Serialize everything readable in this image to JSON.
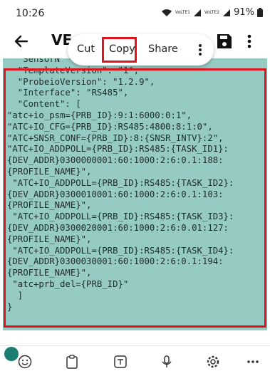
{
  "status_bar": {
    "time": "10:26",
    "network_left": "VoLTE1",
    "network_right": "VoLTE2",
    "battery": "91%"
  },
  "app_bar": {
    "title": "VE",
    "back_icon": "back-arrow-icon",
    "save_icon": "save-icon",
    "more_icon": "more-vertical-icon"
  },
  "context_menu": {
    "cut": "Cut",
    "copy": "Copy",
    "share": "Share",
    "more_icon": "more-vertical-icon"
  },
  "editor": {
    "code_lines": [
      "  \"SensorN",
      "  \"TemplateVersion\": \"1\",",
      "  \"ProbeioVersion\": \"1.2.9\",",
      "  \"Interface\": \"RS485\",",
      "  \"Content\": [",
      "\"atc+io_psm={PRB_ID}:9:1:6000:0:1\",",
      "\"ATC+IO_CFG={PRB_ID}:RS485:4800:8:1:0\",",
      "\"ATC+SNSR_CONF={PRB_ID}:8:{SNSR_INTV}:2\",",
      "\"ATC+IO_ADDPOLL={PRB_ID}:RS485:{TASK_ID1}:",
      "{DEV_ADDR}0300000001:60:1000:2:6:0.1:188:",
      "{PROFILE_NAME}\",",
      " \"ATC+IO_ADDPOLL={PRB_ID}:RS485:{TASK_ID2}:",
      "{DEV_ADDR}0300010001:60:1000:2:6:0.1:103:",
      "{PROFILE_NAME}\",",
      " \"ATC+IO_ADDPOLL={PRB_ID}:RS485:{TASK_ID3}:",
      "{DEV_ADDR}0300020001:60:1000:2:6:0.01:127:",
      "{PROFILE_NAME}\",",
      " \"ATC+IO_ADDPOLL={PRB_ID}:RS485:{TASK_ID4}:",
      "{DEV_ADDR}0300030001:60:1000:2:6:0.1:194:",
      "{PROFILE_NAME}\",",
      " \"atc+prb_del={PRB_ID}\"",
      "  ]",
      "}"
    ]
  },
  "bottom_toolbar": {
    "icons": [
      "emoji-icon",
      "clipboard-icon",
      "microphone-icon",
      "settings-icon",
      "more-horizontal-icon"
    ]
  },
  "colors": {
    "selection": "#95cbc3",
    "highlight_box": "#e0141e",
    "accent_dot": "#1a7d6f"
  }
}
